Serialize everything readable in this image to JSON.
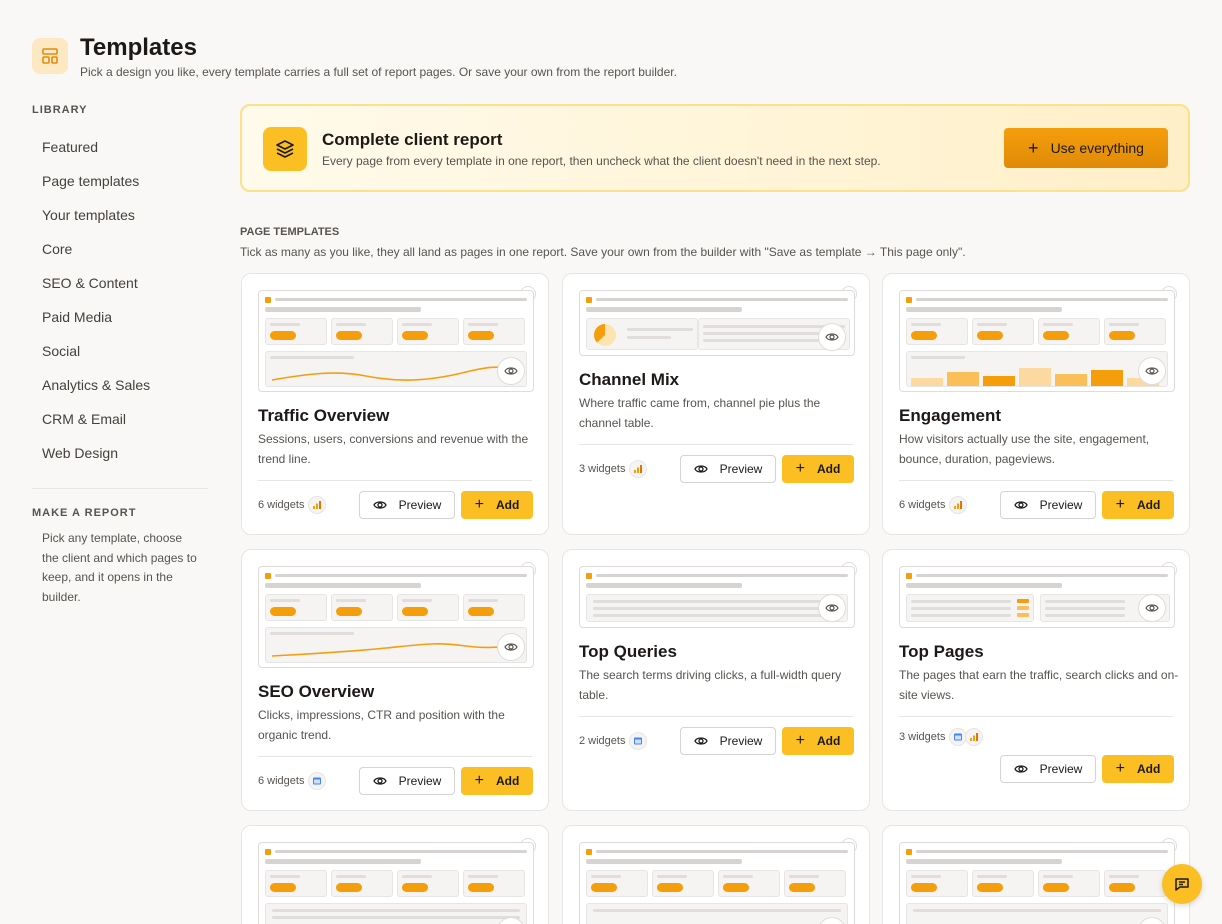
{
  "header": {
    "title": "Templates",
    "subtitle": "Pick a design you like, every template carries a full set of report pages. Or save your own from the report builder.",
    "icon": "layout-template-icon"
  },
  "sidebar": {
    "library_heading": "LIBRARY",
    "items": [
      {
        "label": "Featured"
      },
      {
        "label": "Page templates"
      },
      {
        "label": "Your templates"
      },
      {
        "label": "Core"
      },
      {
        "label": "SEO & Content"
      },
      {
        "label": "Paid Media"
      },
      {
        "label": "Social"
      },
      {
        "label": "Analytics & Sales"
      },
      {
        "label": "CRM & Email"
      },
      {
        "label": "Web Design"
      }
    ],
    "make_heading": "MAKE A REPORT",
    "make_text": "Pick any template, choose the client and which pages to keep, and it opens in the builder."
  },
  "banner": {
    "title": "Complete client report",
    "description": "Every page from every template in one report, then uncheck what the client doesn't need in the next step.",
    "button_label": "Use everything",
    "icon": "layers-icon"
  },
  "section": {
    "heading": "PAGE TEMPLATES",
    "description": "Tick as many as you like, they all land as pages in one report. Save your own from the builder with \"Save as template → This page only\"."
  },
  "cards": [
    {
      "title": "Traffic Overview",
      "description": "Sessions, users, conversions and revenue with the trend line.",
      "widgets": "6 widgets",
      "preview_label": "Preview",
      "add_label": "Add",
      "sources": [
        "analytics-icon"
      ]
    },
    {
      "title": "Channel Mix",
      "description": "Where traffic came from, channel pie plus the channel table.",
      "widgets": "3 widgets",
      "preview_label": "Preview",
      "add_label": "Add",
      "sources": [
        "analytics-icon"
      ]
    },
    {
      "title": "Engagement",
      "description": "How visitors actually use the site, engagement, bounce, duration, pageviews.",
      "widgets": "6 widgets",
      "preview_label": "Preview",
      "add_label": "Add",
      "sources": [
        "analytics-icon"
      ]
    },
    {
      "title": "SEO Overview",
      "description": "Clicks, impressions, CTR and position with the organic trend.",
      "widgets": "6 widgets",
      "preview_label": "Preview",
      "add_label": "Add",
      "sources": [
        "search-console-icon"
      ]
    },
    {
      "title": "Top Queries",
      "description": "The search terms driving clicks, a full-width query table.",
      "widgets": "2 widgets",
      "preview_label": "Preview",
      "add_label": "Add",
      "sources": [
        "search-console-icon"
      ]
    },
    {
      "title": "Top Pages",
      "description": "The pages that earn the traffic, search clicks and on-site views.",
      "widgets": "3 widgets",
      "preview_label": "Preview",
      "add_label": "Add",
      "sources": [
        "search-console-icon",
        "analytics-icon"
      ]
    }
  ],
  "colors": {
    "accent": "#fbbf24",
    "accent_dark": "#f59e0b",
    "background": "#faf8f6",
    "search_console_blue": "#4285f4"
  }
}
